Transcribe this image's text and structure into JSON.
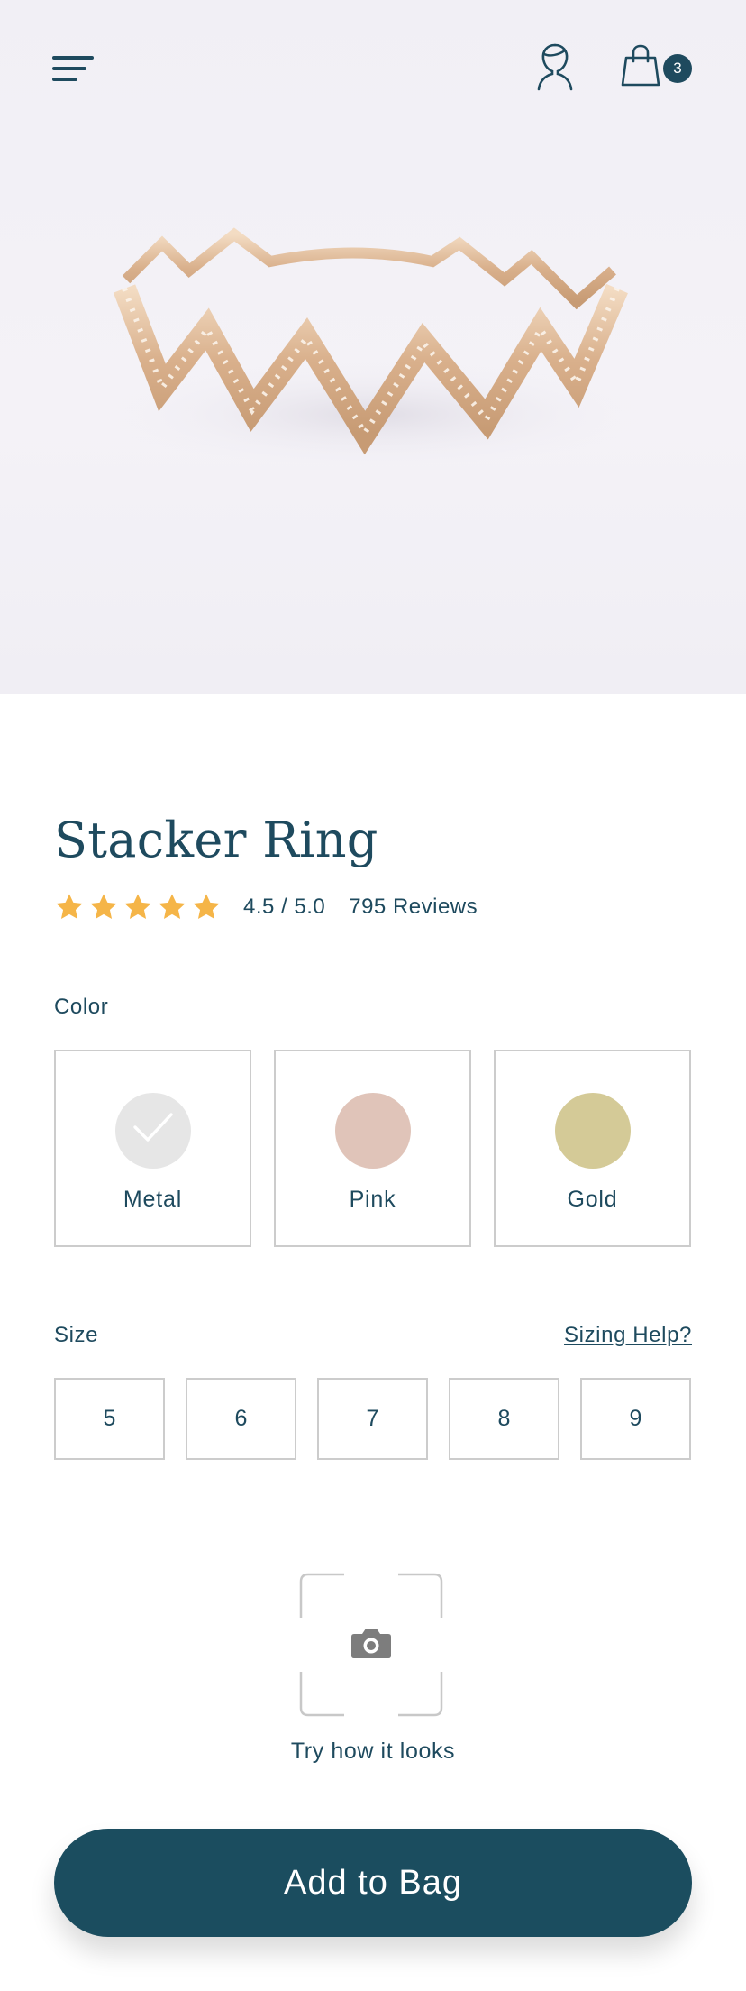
{
  "header": {
    "menu_icon": "hamburger-menu-icon",
    "account_icon": "user-icon",
    "bag_icon": "shopping-bag-icon",
    "bag_count": "3"
  },
  "product": {
    "image_icon": "zigzag-ring-image",
    "name": "Stacker Ring",
    "rating_stars": 5,
    "rating_value": "4.5 / 5.0",
    "reviews": "795 Reviews"
  },
  "color": {
    "label": "Color",
    "options": [
      {
        "name": "Metal",
        "swatch": "#e6e6e6",
        "selected": true
      },
      {
        "name": "Pink",
        "swatch": "#e0c4b9",
        "selected": false
      },
      {
        "name": "Gold",
        "swatch": "#d4ca97",
        "selected": false
      }
    ]
  },
  "size": {
    "label": "Size",
    "help_link": "Sizing Help?",
    "options": [
      "5",
      "6",
      "7",
      "8",
      "9"
    ]
  },
  "try_on": {
    "icon": "camera-icon",
    "label": "Try how it looks"
  },
  "cta": {
    "label": "Add to Bag"
  },
  "colors": {
    "primary": "#1b4d5f",
    "star": "#f5b548",
    "border": "#cccccc"
  }
}
